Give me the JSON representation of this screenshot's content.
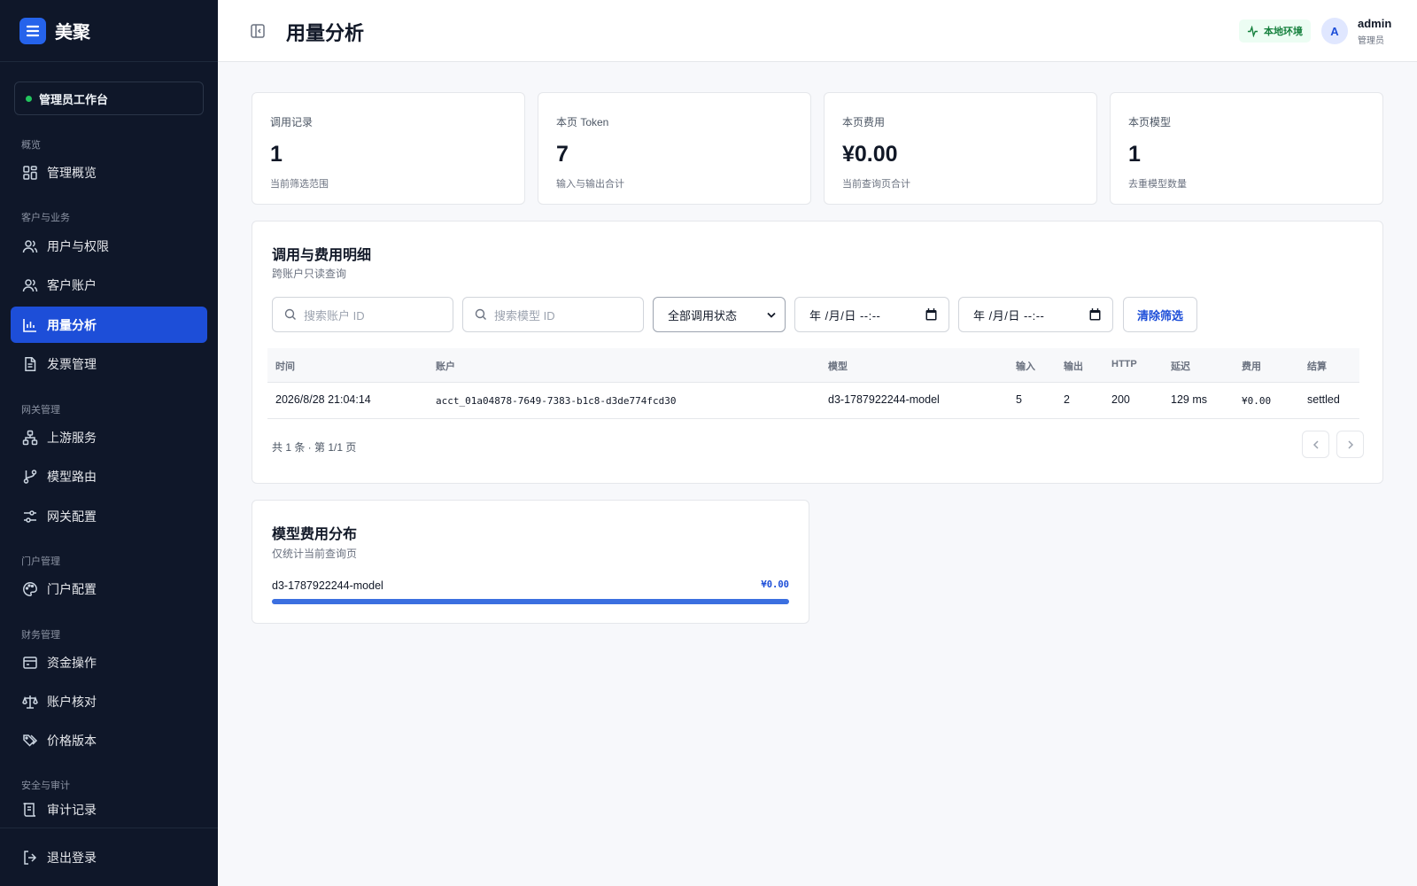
{
  "app": {
    "brand": "美聚",
    "workspace": "管理员工作台"
  },
  "sidebar": {
    "sections": [
      {
        "label": "概览"
      },
      {
        "label": "客户与业务"
      },
      {
        "label": "网关管理"
      },
      {
        "label": "门户管理"
      },
      {
        "label": "财务管理"
      },
      {
        "label": "安全与审计"
      }
    ],
    "items": [
      {
        "label": "管理概览",
        "icon": "dashboard-icon"
      },
      {
        "label": "用户与权限",
        "icon": "users-icon"
      },
      {
        "label": "客户账户",
        "icon": "users-icon"
      },
      {
        "label": "用量分析",
        "icon": "bar-chart-icon",
        "active": true
      },
      {
        "label": "发票管理",
        "icon": "document-icon"
      },
      {
        "label": "上游服务",
        "icon": "network-icon"
      },
      {
        "label": "模型路由",
        "icon": "git-branch-icon"
      },
      {
        "label": "网关配置",
        "icon": "sliders-icon"
      },
      {
        "label": "门户配置",
        "icon": "palette-icon"
      },
      {
        "label": "资金操作",
        "icon": "wallet-icon"
      },
      {
        "label": "账户核对",
        "icon": "scale-icon"
      },
      {
        "label": "价格版本",
        "icon": "tags-icon"
      },
      {
        "label": "审计记录",
        "icon": "scroll-icon"
      }
    ],
    "logout": "退出登录"
  },
  "header": {
    "title": "用量分析",
    "env_badge": "本地环境",
    "user": {
      "avatar": "A",
      "name": "admin",
      "role": "管理员"
    }
  },
  "stats": [
    {
      "label": "调用记录",
      "value": "1",
      "sub": "当前筛选范围"
    },
    {
      "label": "本页 Token",
      "value": "7",
      "sub": "输入与输出合计"
    },
    {
      "label": "本页费用",
      "value": "¥0.00",
      "sub": "当前查询页合计"
    },
    {
      "label": "本页模型",
      "value": "1",
      "sub": "去重模型数量"
    }
  ],
  "details": {
    "title": "调用与费用明细",
    "subtitle": "跨账户只读查询",
    "filters": {
      "account_placeholder": "搜索账户 ID",
      "model_placeholder": "搜索模型 ID",
      "status_selected": "全部调用状态",
      "date_from": "年 /月/日 --:--",
      "date_to": "年 /月/日 --:--",
      "clear_label": "清除筛选"
    },
    "columns": [
      "时间",
      "账户",
      "模型",
      "输入",
      "输出",
      "HTTP",
      "延迟",
      "费用",
      "结算"
    ],
    "rows": [
      {
        "time": "2026/8/28 21:04:14",
        "account": "acct_01a04878-7649-7383-b1c8-d3de774fcd30",
        "model": "d3-1787922244-model",
        "input": "5",
        "output": "2",
        "http": "200",
        "latency": "129 ms",
        "cost": "¥0.00",
        "settlement": "settled"
      }
    ],
    "pagination": "共 1 条 · 第 1/1 页"
  },
  "distribution": {
    "title": "模型费用分布",
    "subtitle": "仅统计当前查询页",
    "items": [
      {
        "model": "d3-1787922244-model",
        "cost": "¥0.00",
        "share": 1.0
      }
    ]
  },
  "colors": {
    "sidebar_bg": "#0f1729",
    "accent": "#1d4ed8",
    "bar": "#3b6fe0",
    "env_badge": "#15803d"
  }
}
